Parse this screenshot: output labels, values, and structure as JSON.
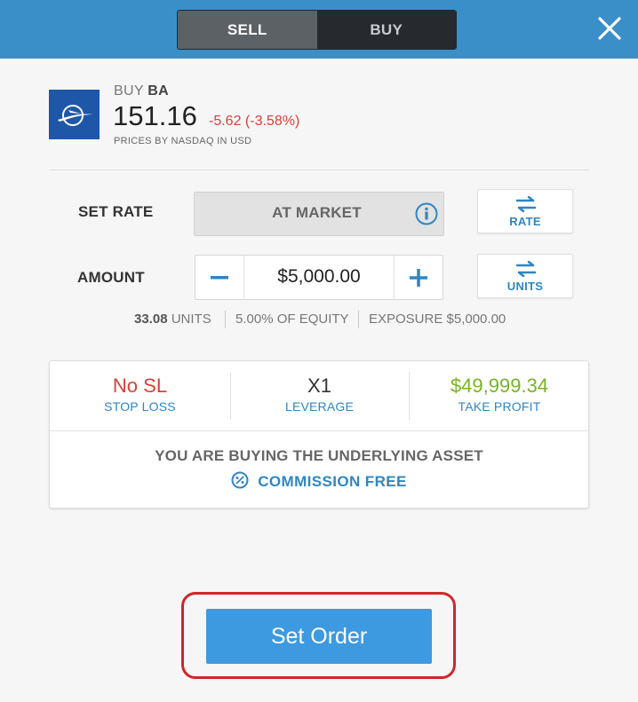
{
  "header": {
    "sell_label": "SELL",
    "buy_label": "BUY",
    "close_icon": "close-icon",
    "background": "#3a8fc9"
  },
  "asset": {
    "action": "BUY",
    "symbol": "BA",
    "price": "151.16",
    "change": "-5.62 (-3.58%)",
    "source": "PRICES BY NASDAQ IN USD",
    "logo_icon": "boeing-logo-icon"
  },
  "rate": {
    "label": "SET RATE",
    "value": "AT MARKET",
    "info_icon": "info-icon",
    "toggle_label": "RATE"
  },
  "amount": {
    "label": "AMOUNT",
    "value": "$5,000.00",
    "toggle_label": "UNITS",
    "meta": {
      "units_value": "33.08",
      "units_label": "UNITS",
      "equity": "5.00% OF EQUITY",
      "exposure": "EXPOSURE $5,000.00"
    }
  },
  "settings": {
    "stop_loss": {
      "value": "No SL",
      "label": "STOP LOSS",
      "color": "#d8403a"
    },
    "leverage": {
      "value": "X1",
      "label": "LEVERAGE",
      "color": "#333333"
    },
    "take_profit": {
      "value": "$49,999.34",
      "label": "TAKE PROFIT",
      "color": "#7ab228"
    },
    "note": "YOU ARE BUYING THE UNDERLYING ASSET",
    "commission": "COMMISSION FREE"
  },
  "order_button": "Set Order",
  "colors": {
    "accent": "#2f86c2",
    "highlight": "#d1252b",
    "button": "#3d9ae0"
  }
}
